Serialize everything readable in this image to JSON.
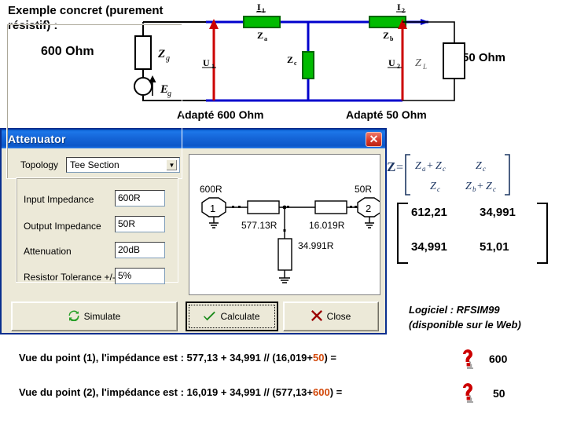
{
  "slide": {
    "title": "Exemple concret (purement résistif) :",
    "source_left": "600 Ohm",
    "source_right": "50 Ohm",
    "adapt_left": "Adapté 600 Ohm",
    "adapt_right": "Adapté 50 Ohm",
    "software_note_line1": "Logiciel : RFSIM99",
    "software_note_line2": "(disponible sur le Web)"
  },
  "circuit": {
    "labels": {
      "zg": "Zg",
      "eg": "Eg",
      "i1": "I1",
      "u1": "U1",
      "za": "Za",
      "zc": "Zc",
      "zb": "Zb",
      "i2": "I2",
      "u2": "U2",
      "zl": "ZL"
    },
    "colors": {
      "wire_blue": "#0000cc",
      "resistor_green": "#00bb00",
      "arrow_red": "#cc0000"
    }
  },
  "dialog": {
    "title": "Attenuator",
    "close_icon": "✕",
    "topology": {
      "label": "Topology",
      "value": "Tee Section",
      "arrow": "▼"
    },
    "fields": [
      {
        "label": "Input Impedance",
        "value": "600R"
      },
      {
        "label": "Output Impedance",
        "value": "50R"
      },
      {
        "label": "Attenuation",
        "value": "20dB"
      },
      {
        "label": "Resistor Tolerance +/-",
        "value": "5%"
      }
    ],
    "buttons": {
      "simulate": "Simulate",
      "calculate": "Calculate",
      "close": "Close"
    },
    "schematic": {
      "port1_label": "600R",
      "port1_number": "1",
      "port2_label": "50R",
      "port2_number": "2",
      "series_r1": "577.13R",
      "series_r2": "16.019R",
      "shunt_r": "34.991R"
    }
  },
  "matrix": {
    "symbol": "Z =",
    "cells_symbolic": [
      [
        "Za + Zc",
        "Zc"
      ],
      [
        "Zc",
        "Zb + Zc"
      ]
    ],
    "values": [
      [
        "612,21",
        "34,991"
      ],
      [
        "34,991",
        "51,01"
      ]
    ]
  },
  "statements": [
    {
      "prefix": "Vue du point (1), l'impédance est : 577,13 + 34,991 // (16,019+",
      "highlight": "50",
      "suffix": ") = ",
      "answer": "600"
    },
    {
      "prefix": "Vue du point (2), l'impédance est : 16,019 + 34,991 // (577,13+",
      "highlight": "600",
      "suffix": ") = ",
      "answer": "50"
    }
  ]
}
